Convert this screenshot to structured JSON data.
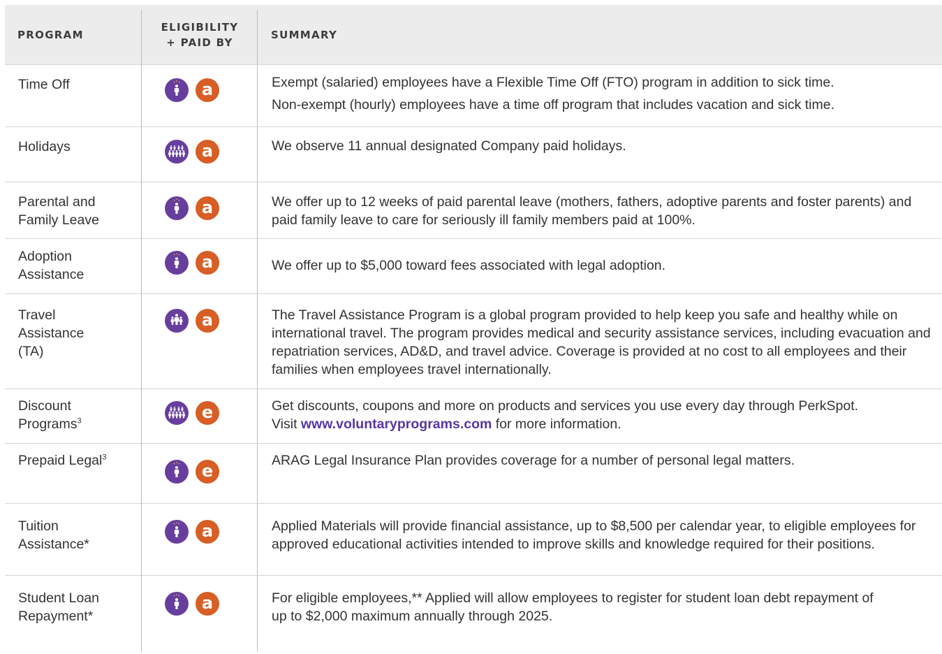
{
  "header": {
    "program": "PROGRAM",
    "eligibility_line1": "ELIGIBILITY",
    "eligibility_line2": "+ PAID BY",
    "summary": "SUMMARY"
  },
  "icon_legend": {
    "eligibility_colors": {
      "person": "#673e9e"
    },
    "paid_by_colors": {
      "letter": "#d75e25"
    }
  },
  "rows": [
    {
      "program": "Time Off",
      "program_sup": "",
      "eligibility_icon": "employee-icon",
      "paid_by": "a",
      "summary": "Exempt (salaried) employees have a Flexible Time Off (FTO) program in addition to sick time.",
      "summary_2": "Non-exempt (hourly) employees have a time off program that includes vacation and sick time."
    },
    {
      "program": "Holidays",
      "program_sup": "",
      "eligibility_icon": "group-icon",
      "paid_by": "a",
      "summary": "We observe 11 annual designated Company paid holidays."
    },
    {
      "program": "Parental and Family Leave",
      "program_sup": "",
      "eligibility_icon": "employee-icon",
      "paid_by": "a",
      "summary": "We offer up to 12 weeks of paid parental leave (mothers, fathers, adoptive parents and foster parents) and paid family leave to care for seriously ill family members paid at 100%."
    },
    {
      "program": "Adoption Assistance",
      "program_sup": "",
      "eligibility_icon": "employee-icon",
      "paid_by": "a",
      "summary": "We offer up to $5,000 toward fees associated with legal adoption."
    },
    {
      "program": "Travel Assistance (TA)",
      "program_sup": "",
      "eligibility_icon": "family-icon",
      "paid_by": "a",
      "summary": "The Travel Assistance Program is a global program provided to help keep you safe and healthy while on international travel. The program provides medical and security assistance services, including evacuation and repatriation services, AD&D, and travel advice. Coverage is provided at no cost to all employees and their families when employees travel internationally."
    },
    {
      "program": "Discount Programs",
      "program_sup": "3",
      "eligibility_icon": "group-icon",
      "paid_by": "e",
      "summary": "Get discounts, coupons and more on products and services you use every day through PerkSpot.",
      "summary_pre": "Visit ",
      "summary_link": "www.voluntaryprograms.com",
      "summary_post": " for more information."
    },
    {
      "program": "Prepaid Legal",
      "program_sup": "3",
      "eligibility_icon": "employee-icon",
      "paid_by": "e",
      "summary": "ARAG Legal Insurance Plan provides coverage for a number of personal legal matters."
    },
    {
      "program": "Tuition Assistance*",
      "program_sup": "",
      "eligibility_icon": "employee-icon",
      "paid_by": "a",
      "summary": "Applied Materials will provide financial assistance, up to $8,500 per calendar year, to eligible employees for approved educational activities intended to improve skills and knowledge required for their positions."
    },
    {
      "program": "Student Loan Repayment*",
      "program_sup": "",
      "eligibility_icon": "employee-icon",
      "paid_by": "a",
      "summary": "For eligible employees,** Applied will allow employees to register for student loan debt repayment of up to $2,000 maximum annually through 2025."
    }
  ]
}
